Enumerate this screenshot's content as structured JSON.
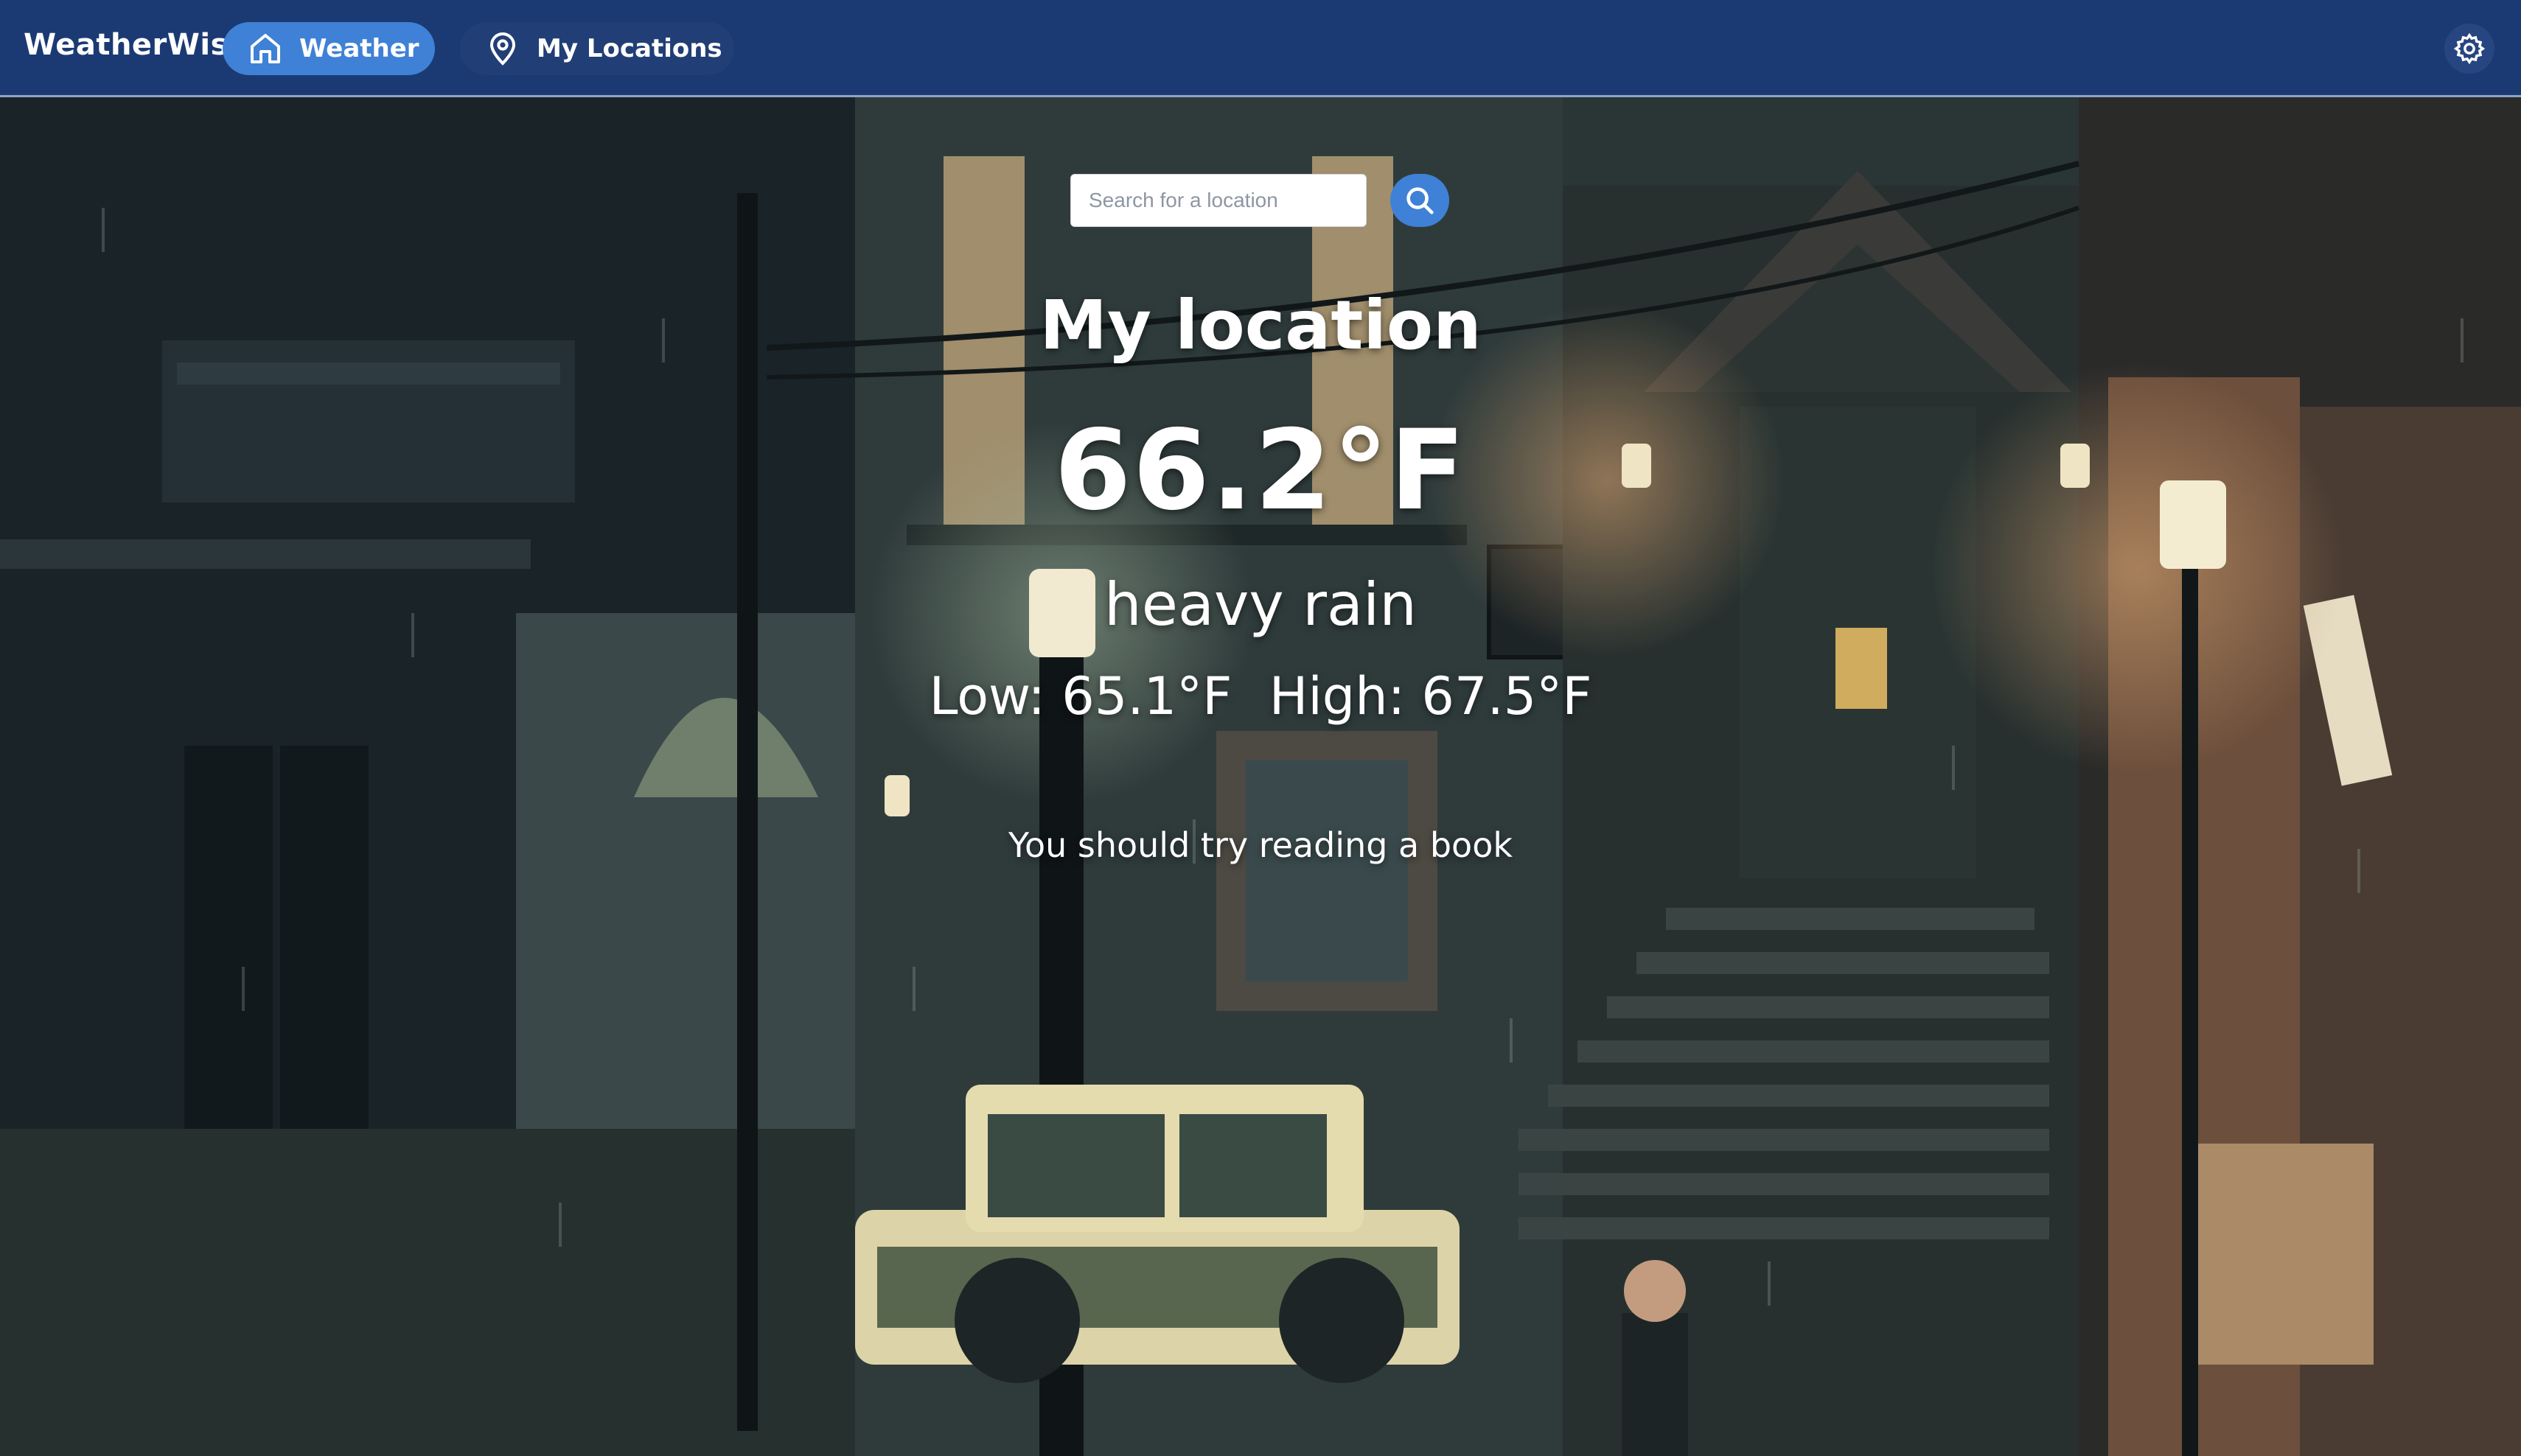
{
  "app": {
    "brand": "WeatherWise"
  },
  "nav": {
    "weather_label": "Weather",
    "locations_label": "My Locations"
  },
  "icons": {
    "home": "home-icon",
    "pin": "map-pin-icon",
    "gear": "gear-icon",
    "search": "search-icon"
  },
  "colors": {
    "navbar": "#1b3a73",
    "accent": "#3f81d6"
  },
  "search": {
    "placeholder": "Search for a location",
    "value": ""
  },
  "weather": {
    "location": "My location",
    "temperature": "66.2°F",
    "condition": "heavy rain",
    "low": "Low: 65.1°F",
    "high": "High: 67.5°F",
    "suggestion": "You should try reading a book"
  }
}
